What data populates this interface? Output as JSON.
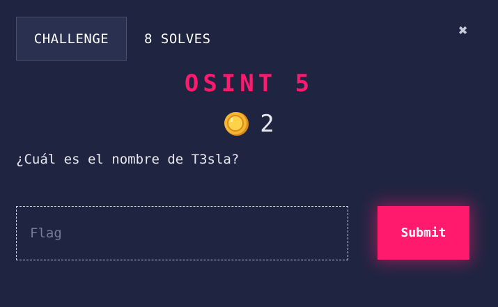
{
  "tabs": {
    "challenge_label": "CHALLENGE",
    "solves_label": "8 SOLVES"
  },
  "close_icon": "close-icon",
  "challenge": {
    "title": "OSINT 5",
    "points": "2",
    "points_icon": "coin-icon",
    "question": "¿Cuál es el nombre de T3sla?"
  },
  "form": {
    "flag_placeholder": "Flag",
    "flag_value": "",
    "submit_label": "Submit"
  },
  "colors": {
    "background": "#1f2541",
    "accent": "#ff1a6e",
    "tab_active_bg": "#2a3050",
    "coin": "#f5b731"
  }
}
